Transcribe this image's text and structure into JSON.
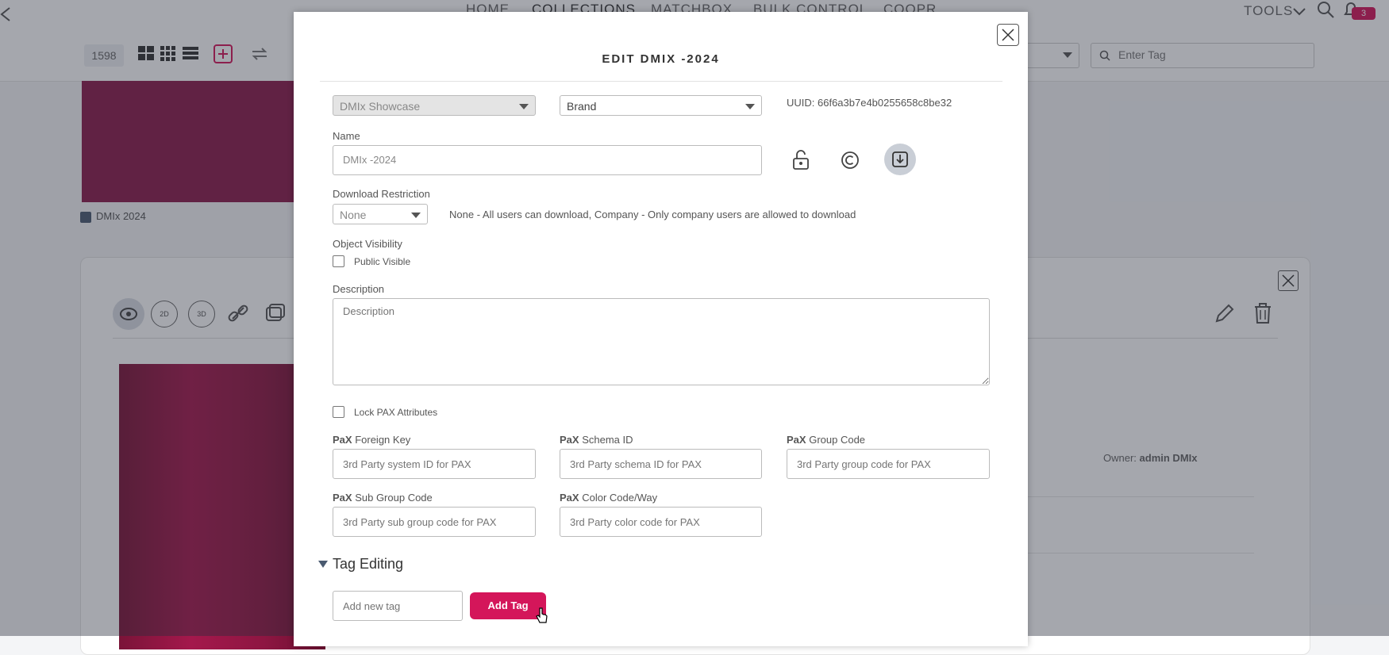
{
  "nav": {
    "links": [
      "HOME",
      "COLLECTIONS",
      "MATCHBOX",
      "BULK CONTROL",
      "COOPR"
    ],
    "tools_label": "TOOLS",
    "notification_count": "3"
  },
  "toolbar": {
    "item_count": "1598",
    "tag_search_placeholder": "Enter Tag"
  },
  "background": {
    "thumb_caption": "DMIx 2024",
    "owner_label": "Owner:",
    "owner_value": "admin DMIx",
    "card_view_labels": [
      "2D",
      "3D"
    ]
  },
  "modal": {
    "title": "EDIT DMIX -2024",
    "collection_select": "DMIx Showcase",
    "type_select": "Brand",
    "uuid": "UUID: 66f6a3b7e4b0255658c8be32",
    "name_label": "Name",
    "name_value": "DMIx -2024",
    "download_label": "Download Restriction",
    "download_value": "None",
    "download_help": "None - All users can download, Company - Only company users are allowed to download",
    "visibility_label": "Object Visibility",
    "public_visible_label": "Public Visible",
    "description_label": "Description",
    "description_placeholder": "Description",
    "lock_pax_label": "Lock PAX Attributes",
    "pax_prefix": "PaX",
    "pax_fields": [
      {
        "label": "Foreign Key",
        "placeholder": "3rd Party system ID for PAX"
      },
      {
        "label": "Schema ID",
        "placeholder": "3rd Party schema ID for PAX"
      },
      {
        "label": "Group Code",
        "placeholder": "3rd Party group code for PAX"
      },
      {
        "label": "Sub Group Code",
        "placeholder": "3rd Party sub group code for PAX"
      },
      {
        "label": "Color Code/Way",
        "placeholder": "3rd Party color code for PAX"
      }
    ],
    "tag_section_title": "Tag Editing",
    "new_tag_placeholder": "Add new tag",
    "add_tag_label": "Add Tag"
  },
  "colors": {
    "accent": "#d4165a",
    "thumbnail": "#8a1a4a",
    "overlay": "rgba(40,45,60,0.42)"
  }
}
